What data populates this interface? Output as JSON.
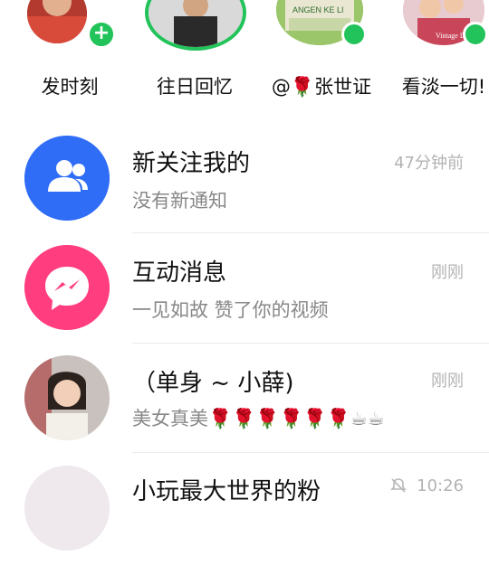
{
  "stories": [
    {
      "label": "发时刻",
      "badge": "+"
    },
    {
      "label": "往日回忆"
    },
    {
      "label": "@🌹张世证",
      "photo_text": "ANGEN KE LI"
    },
    {
      "label": "看淡一切!",
      "photo_text": "Vintage Dream"
    }
  ],
  "messages": [
    {
      "title": "新关注我的",
      "subtitle": "没有新通知",
      "time": "47分钟前",
      "icon": "users-icon",
      "color": "#2f6df6"
    },
    {
      "title": "互动消息",
      "subtitle": "一见如故 赞了你的视频",
      "time": "刚刚",
      "icon": "message-icon",
      "color": "#ff3d7f"
    },
    {
      "title": "（单身 ~ 小薛)",
      "subtitle": "美女真美🌹🌹🌹🌹🌹🌹☕☕",
      "time": "刚刚",
      "icon": "person-avatar"
    },
    {
      "title": "小玩最大世界的粉",
      "time": "10:26",
      "icon": "mute-icon"
    }
  ],
  "colors": {
    "accent_green": "#22c35a"
  }
}
